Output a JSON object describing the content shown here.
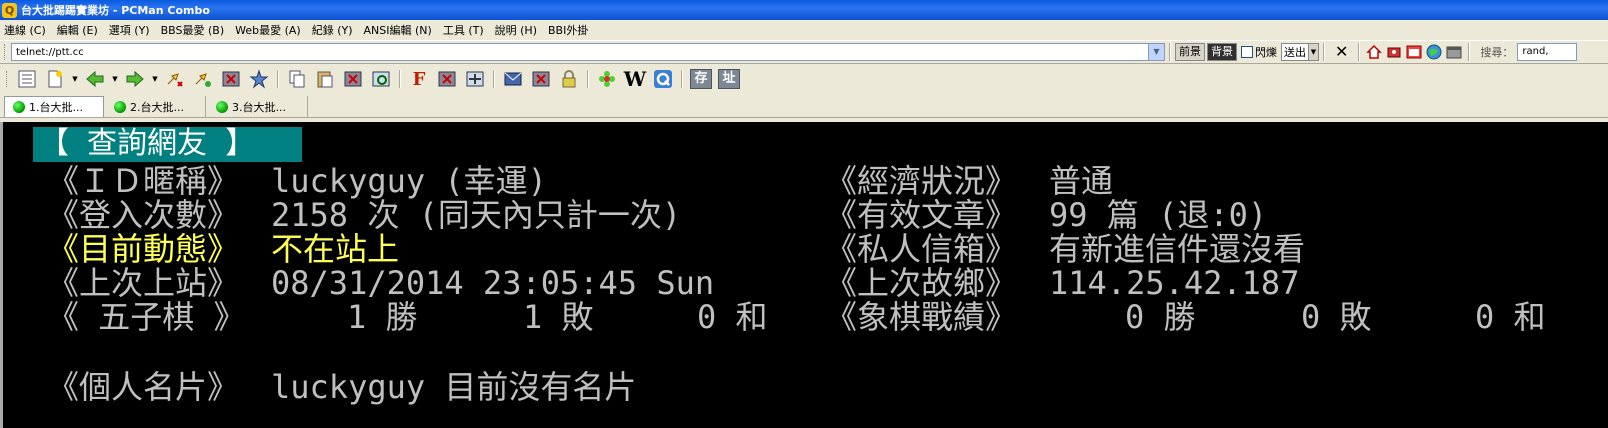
{
  "window": {
    "title": "台大批踢踢實業坊 - PCMan Combo",
    "icon": "pcman-icon"
  },
  "menu": [
    "連線 (C)",
    "編輯 (E)",
    "選項 (Y)",
    "BBS最愛 (B)",
    "Web最愛 (A)",
    "紀錄 (Y)",
    "ANSI編輯 (N)",
    "工具 (T)",
    "說明 (H)",
    "BBI外掛"
  ],
  "address": {
    "url": "telnet://ptt.cc",
    "fg_label": "前景",
    "bg_label": "背景",
    "blink_label": "閃爍",
    "send_label": "送出",
    "search_label": "搜尋：",
    "search_value": "rand,"
  },
  "tabs": [
    {
      "label": "1.台大批..."
    },
    {
      "label": "2.台大批..."
    },
    {
      "label": "3.台大批..."
    }
  ],
  "toolbar": {
    "store_label": "存",
    "addr_label": "址"
  },
  "colors": {
    "terminal_bg": "#000000",
    "terminal_fg": "#c0c0c0",
    "highlight": "#ffff55",
    "header_bg": "#008080"
  },
  "profile": {
    "header": "【 查詢網友 】",
    "rows": [
      {
        "label": "《ＩＤ暱稱》",
        "value": "luckyguy (幸運)",
        "label2": "《經濟狀況》",
        "value2": "普通"
      },
      {
        "label": "《登入次數》",
        "value": "2158 次 (同天內只計一次)",
        "label2": "《有效文章》",
        "value2": "99 篇 (退:0)"
      },
      {
        "label": "《目前動態》",
        "value": "不在站上",
        "label2": "《私人信箱》",
        "value2": "有新進信件還沒看"
      },
      {
        "label": "《上次上站》",
        "value": "08/31/2014 23:05:45 Sun",
        "label2": "《上次故鄉》",
        "value2": "114.25.42.187"
      }
    ],
    "gomoku_label": "《 五子棋 》",
    "gomoku_win": "1 勝",
    "gomoku_lose": "1 敗",
    "gomoku_draw": "0 和",
    "chess_label": "《象棋戰績》",
    "chess_win": "0 勝",
    "chess_lose": "0 敗",
    "chess_draw": "0 和",
    "card_label": "《個人名片》",
    "card_value": "luckyguy 目前沒有名片"
  }
}
